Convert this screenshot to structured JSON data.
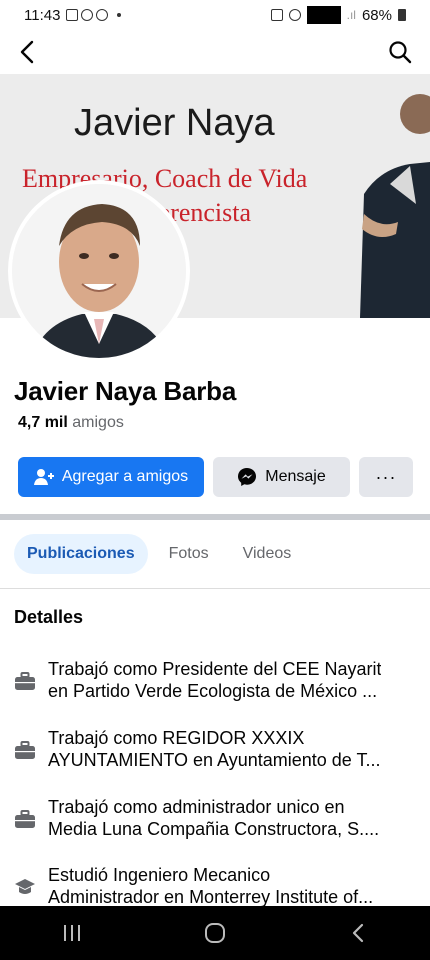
{
  "status_bar": {
    "time": "11:43",
    "battery": "68%"
  },
  "profile": {
    "cover": {
      "title": "Javier Naya",
      "subtitle_line1": "Empresario, Coach de Vida",
      "subtitle_line2": "ferencista"
    },
    "name": "Javier Naya Barba",
    "friends_count": "4,7 mil",
    "friends_label": "amigos"
  },
  "actions": {
    "add_friend": "Agregar a amigos",
    "message": "Mensaje",
    "more": "···"
  },
  "tabs": [
    {
      "label": "Publicaciones",
      "active": true
    },
    {
      "label": "Fotos",
      "active": false
    },
    {
      "label": "Videos",
      "active": false
    }
  ],
  "details": {
    "title": "Detalles",
    "items": [
      {
        "icon": "briefcase-icon",
        "line1": "Trabajó como Presidente del CEE Nayarit",
        "line2": "en Partido Verde Ecologista de México ..."
      },
      {
        "icon": "briefcase-icon",
        "line1": "Trabajó como REGIDOR XXXIX",
        "line2": "AYUNTAMIENTO en Ayuntamiento de T..."
      },
      {
        "icon": "briefcase-icon",
        "line1": "Trabajó como administrador unico en",
        "line2": "Media Luna Compañia Constructora, S...."
      },
      {
        "icon": "graduation-cap-icon",
        "line1": "Estudió Ingeniero Mecanico",
        "line2": "Administrador en Monterrey Institute of..."
      }
    ]
  },
  "colors": {
    "primary": "#1877f2",
    "secondary_bg": "#e4e6eb",
    "tab_active_bg": "#e7f3ff",
    "tab_active_text": "#1b5ab4",
    "cover_red": "#c9232b"
  }
}
